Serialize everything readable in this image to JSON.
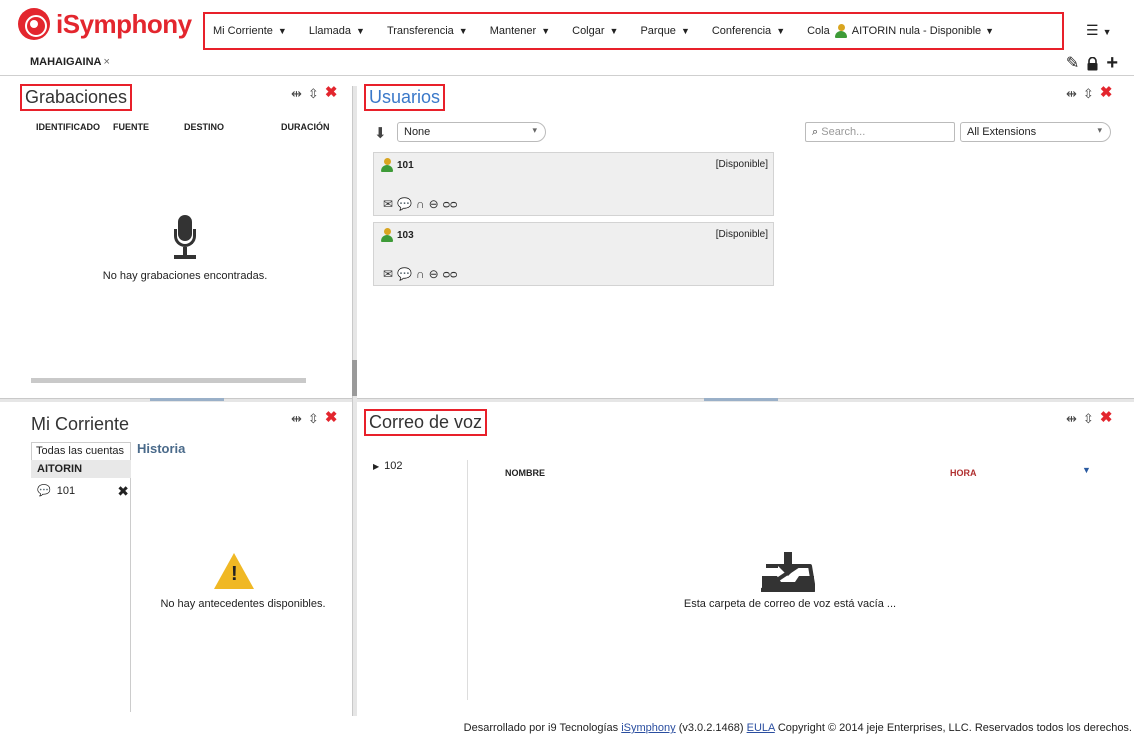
{
  "app": {
    "logo_text": "iSymphony",
    "brand_color": "#e3262e",
    "accent_color": "#e8202a"
  },
  "menu": {
    "items": [
      {
        "label": "Mi Corriente"
      },
      {
        "label": "Llamada"
      },
      {
        "label": "Transferencia"
      },
      {
        "label": "Mantener"
      },
      {
        "label": "Colgar"
      },
      {
        "label": "Parque"
      },
      {
        "label": "Conferencia"
      }
    ],
    "queue_label": "Cola",
    "agent_status": "AITORIN nula - Disponible"
  },
  "tab": {
    "label": "MAHAIGAINA",
    "close": "×"
  },
  "recordings": {
    "title": "Grabaciones",
    "columns": [
      "IDENTIFICADO",
      "FUENTE",
      "DESTINO",
      "DURACIÓN"
    ],
    "empty": "No hay grabaciones encontradas."
  },
  "users": {
    "title": "Usuarios",
    "sort_value": "None",
    "search_placeholder": "Search...",
    "filter_value": "All Extensions",
    "list": [
      {
        "ext": "101",
        "status": "[Disponible]"
      },
      {
        "ext": "103",
        "status": "[Disponible]"
      }
    ]
  },
  "current": {
    "title": "Mi Corriente",
    "account_tab": "Todas las cuentas",
    "account_name": "AITORIN",
    "call_ext": "101",
    "history_title": "Historia",
    "empty": "No hay antecedentes disponibles."
  },
  "voicemail": {
    "title": "Correo de voz",
    "folder": "102",
    "col_name": "NOMBRE",
    "col_time": "HORA",
    "empty": "Esta carpeta de correo de voz está vacía ..."
  },
  "footer": {
    "prefix": "Desarrollado por i9 Tecnologías",
    "product_link": "iSymphony",
    "version": "(v3.0.2.1468)",
    "eula_link": "EULA",
    "copyright": "Copyright © 2014 jeje Enterprises, LLC. Reservados todos los derechos."
  }
}
